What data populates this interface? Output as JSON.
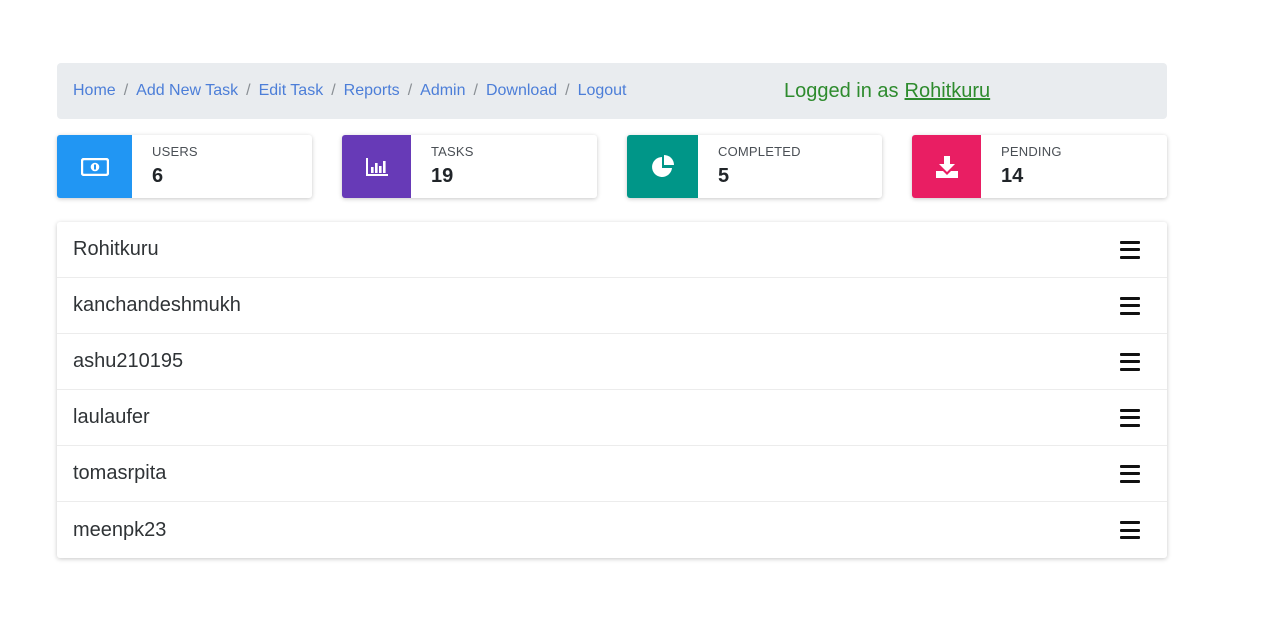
{
  "nav": {
    "links": [
      "Home",
      "Add New Task",
      "Edit Task",
      "Reports",
      "Admin",
      "Download",
      "Logout"
    ],
    "separator": "/",
    "login_prefix": "Logged in as",
    "login_user": "Rohitkuru"
  },
  "stats": [
    {
      "label": "USERS",
      "value": "6",
      "icon": "money-icon",
      "color": "#2196f3"
    },
    {
      "label": "TASKS",
      "value": "19",
      "icon": "bar-chart-icon",
      "color": "#673ab7"
    },
    {
      "label": "COMPLETED",
      "value": "5",
      "icon": "pie-chart-icon",
      "color": "#009688"
    },
    {
      "label": "PENDING",
      "value": "14",
      "icon": "download-icon",
      "color": "#e91e63"
    }
  ],
  "users": [
    {
      "name": "Rohitkuru",
      "action_icon": "menu-icon"
    },
    {
      "name": "kanchandeshmukh",
      "action_icon": "menu-icon"
    },
    {
      "name": "ashu210195",
      "action_icon": "menu-icon"
    },
    {
      "name": "laulaufer",
      "action_icon": "menu-icon"
    },
    {
      "name": "tomasrpita",
      "action_icon": "menu-icon"
    },
    {
      "name": "meenpk23",
      "action_icon": "menu-icon"
    }
  ]
}
